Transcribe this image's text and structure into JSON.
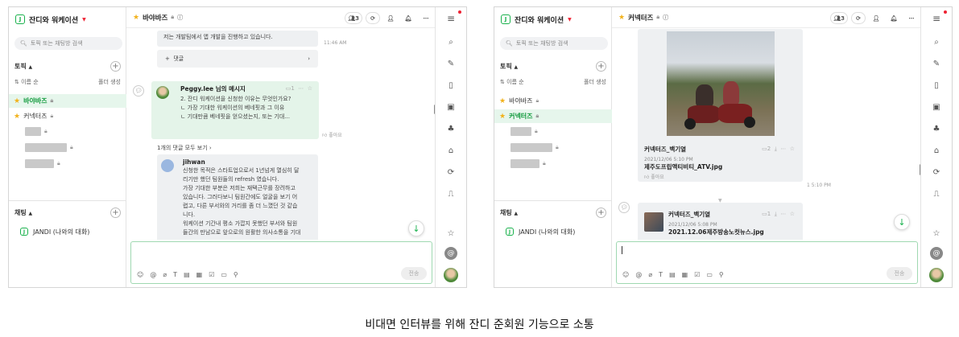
{
  "left": {
    "team_name": "잔디와 워케이션",
    "search_placeholder": "토픽 또는 채팅방 검색",
    "topics_header": "토픽",
    "sort_label": "이름 순",
    "create_label": "폴더 생성",
    "topics": [
      {
        "name": "바야바즈",
        "starred": true,
        "selected": true
      },
      {
        "name": "커넥터즈",
        "starred": true,
        "selected": false
      }
    ],
    "chat_header": "채팅",
    "chat_item": "JANDI (나와의 대화)",
    "topic_title": "바야바즈",
    "member_count": "3",
    "msg_top_text": "저는 개발팀에서 앱 개발을 진행하고 있습니다.",
    "msg_top_time": "11:46 AM",
    "comment_label": "댓글",
    "peggy_title": "Peggy.lee 님의 메시지",
    "peggy_unread": "1",
    "peggy_lines": [
      "2. 잔디 워케이션을 신청한 이유는 무엇인가요?",
      "ㄴ 가장 기대한 워케이션의 베네핏과 그 이유",
      "ㄴ 기대만큼 베네핏을 얻으셨는지, 또는 기대..."
    ],
    "like_label": "좋아요",
    "more_replies": "1개의 댓글 모두 보기",
    "reply_name": "jihwan",
    "reply_lines": [
      "신청한 목적은 스타트업으로서 1년넘게 열심히 달",
      "리기만 했던 팀원들의 refresh 였습니다.",
      "가장 기대한 부분은 저희는 재택근무를 장려하고",
      "있습니다. 그러다보니 팀원간에도 얼굴을 보기 어",
      "렵고, 다른 부서와의 거리를 좀 더 느꼈던 것 같습",
      "니다.",
      "워케이션 기간내 평소 가깝지 못했던 부서와 팀원",
      "들간의 만남으로 앞으로의 원활한 의사소통을 기대"
    ],
    "send_label": "전송"
  },
  "right": {
    "team_name": "잔디와 워케이션",
    "search_placeholder": "토픽 또는 채팅방 검색",
    "topics_header": "토픽",
    "sort_label": "이름 순",
    "create_label": "폴더 생성",
    "topics": [
      {
        "name": "바야바즈",
        "starred": true,
        "selected": false
      },
      {
        "name": "커넥터즈",
        "starred": true,
        "selected": true
      }
    ],
    "chat_header": "채팅",
    "chat_item": "JANDI (나와의 대화)",
    "topic_title": "커넥터즈",
    "member_count": "3",
    "file1_sender": "커넥터즈_백기열",
    "file1_date": "2021/12/06 5:10 PM",
    "file1_name": "제주도프립액티비티_ATV.jpg",
    "file1_unread": "2",
    "file1_like": "좋아요",
    "file1_time": "1  5:10 PM",
    "file2_sender": "커넥터즈_백기열",
    "file2_date": "2021/12/06 5:08 PM",
    "file2_name": "2021.12.06제주방송노컷뉴스.jpg",
    "file2_unread": "1",
    "send_label": "전송"
  },
  "caption": "비대면 인터뷰를 위해 잔디 준회원 기능으로 소통",
  "colors": {
    "brand": "#19b14c",
    "alert": "#e23333",
    "star": "#f2b21b"
  }
}
